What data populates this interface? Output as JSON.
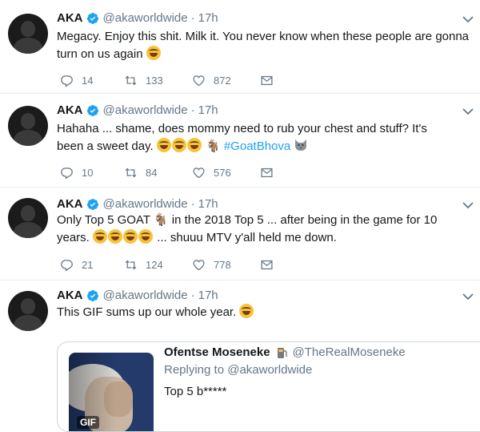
{
  "colors": {
    "accent": "#1da1f2",
    "muted": "#657786",
    "text": "#14171a",
    "divider": "#e6ecf0"
  },
  "icons": {
    "verified": "verified-badge-icon",
    "reply": "reply-icon",
    "retweet": "retweet-icon",
    "like": "heart-icon",
    "dm": "envelope-icon",
    "more": "chevron-down-icon"
  },
  "tweets": [
    {
      "name": "AKA",
      "handle": "@akaworldwide",
      "dot": "·",
      "time": "17h",
      "text": "Megacy. Enjoy this shit. Milk it. You never know when these people are gonna turn on us again",
      "replies": "14",
      "retweets": "133",
      "likes": "872"
    },
    {
      "name": "AKA",
      "handle": "@akaworldwide",
      "dot": "·",
      "time": "17h",
      "text": "Hahaha ... shame, does mommy need to rub your chest and stuff? It's been a sweet day.",
      "hashtag": "#GoatBhova",
      "replies": "10",
      "retweets": "84",
      "likes": "576"
    },
    {
      "name": "AKA",
      "handle": "@akaworldwide",
      "dot": "·",
      "time": "17h",
      "text_a": "Only Top 5 GOAT",
      "text_b": "in the 2018 Top 5 ... after being in the game for 10 years.",
      "text_c": "... shuuu MTV y'all held me down.",
      "replies": "21",
      "retweets": "124",
      "likes": "778"
    },
    {
      "name": "AKA",
      "handle": "@akaworldwide",
      "dot": "·",
      "time": "17h",
      "text": "This GIF sums up our whole year.",
      "quote": {
        "name": "Ofentse Moseneke",
        "handle": "@TheRealMoseneke",
        "replying_prefix": "Replying to",
        "replying_to": "@akaworldwide",
        "text": "Top 5 b*****",
        "media_badge": "GIF"
      }
    }
  ]
}
